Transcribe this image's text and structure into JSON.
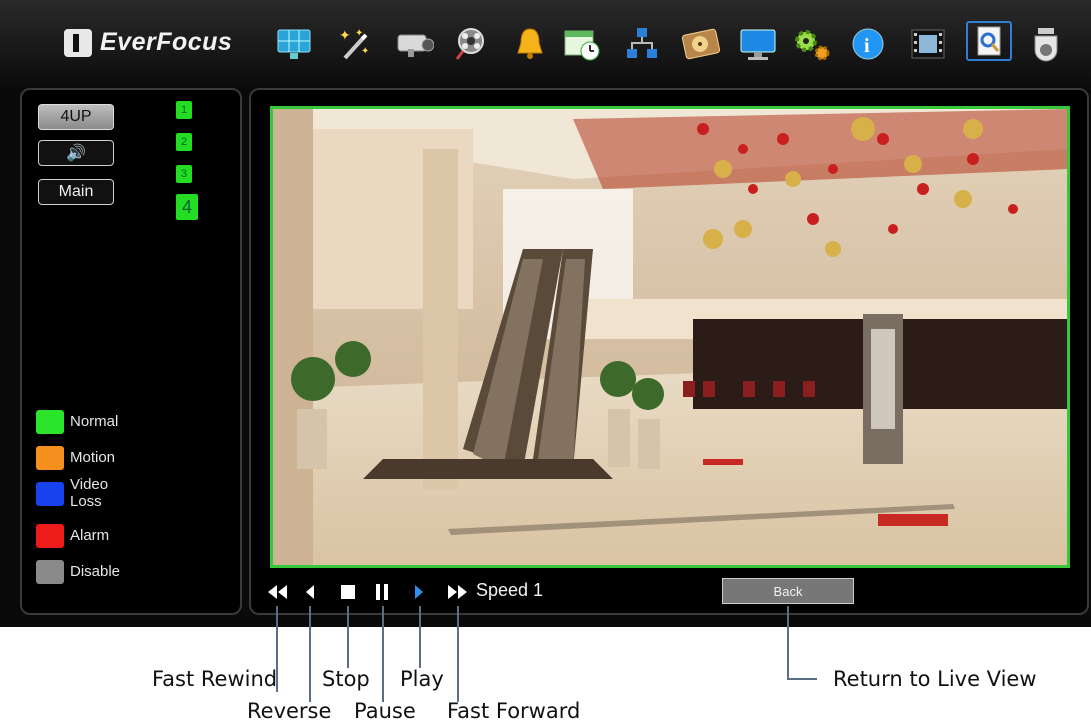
{
  "app": {
    "brand": "EverFocus"
  },
  "toolbar": {
    "icons": [
      "display-icon",
      "wand-icon",
      "camera-icon",
      "film-search-icon",
      "bell-icon",
      "schedule-icon",
      "network-icon",
      "disk-icon",
      "monitor-icon",
      "gears-icon",
      "info-icon",
      "film-icon",
      "search-doc-icon",
      "dome-camera-icon"
    ],
    "selected": "search-doc-icon"
  },
  "left": {
    "layout_btn": "4UP",
    "audio_glyph": "🔊",
    "main_btn": "Main",
    "channels": [
      "1",
      "2",
      "3",
      "4"
    ]
  },
  "legend": [
    {
      "label": "Normal",
      "color": "#2be52b"
    },
    {
      "label": "Motion",
      "color": "#f5901e"
    },
    {
      "label": "Video Loss",
      "color": "#1742ee"
    },
    {
      "label": "Alarm",
      "color": "#ee1b1b"
    },
    {
      "label": "Disable",
      "color": "#8a8a8a"
    }
  ],
  "playback": {
    "speed_label": "Speed 1",
    "back_label": "Back",
    "video_border_color": "#35c93a",
    "active_control": "play"
  },
  "callouts": {
    "fast_rewind": "Fast Rewind",
    "reverse": "Reverse",
    "stop": "Stop",
    "pause": "Pause",
    "play": "Play",
    "fast_forward": "Fast Forward",
    "return_live": "Return to Live View"
  }
}
